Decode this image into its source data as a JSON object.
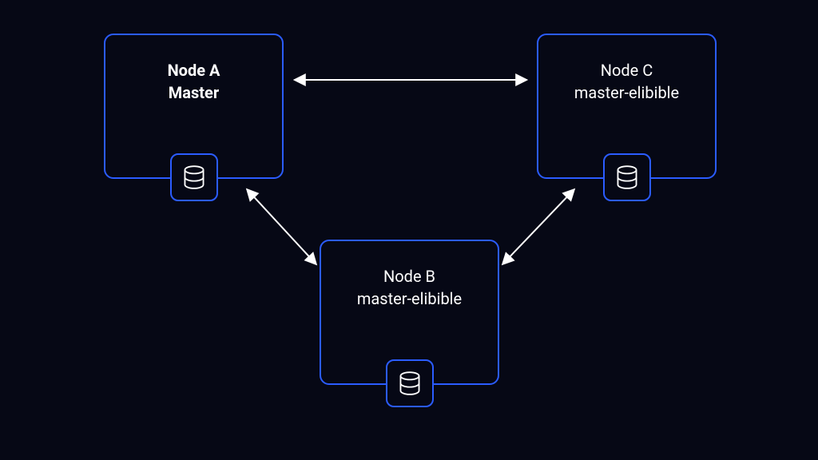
{
  "nodes": {
    "a": {
      "title": "Node A",
      "role": "Master"
    },
    "b": {
      "title": "Node B",
      "role": "master-elibible"
    },
    "c": {
      "title": "Node C",
      "role": "master-elibible"
    }
  },
  "colors": {
    "background": "#060815",
    "border": "#2B5CFF",
    "text": "#FFFFFF",
    "arrow": "#FFFFFF"
  },
  "diagram": {
    "type": "cluster-topology",
    "edges": [
      {
        "from": "a",
        "to": "c",
        "bidirectional": true
      },
      {
        "from": "a",
        "to": "b",
        "bidirectional": true
      },
      {
        "from": "b",
        "to": "c",
        "bidirectional": true
      }
    ]
  }
}
